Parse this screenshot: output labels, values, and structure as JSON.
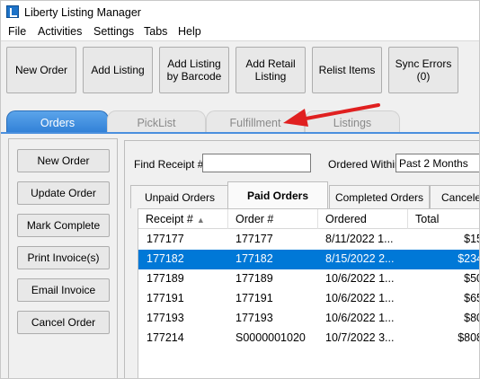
{
  "app": {
    "title": "Liberty Listing Manager"
  },
  "menu": [
    "File",
    "Activities",
    "Settings",
    "Tabs",
    "Help"
  ],
  "toolbar": {
    "new_order": "New Order",
    "add_listing": "Add Listing",
    "add_by_barcode": "Add Listing\nby Barcode",
    "add_retail": "Add Retail\nListing",
    "relist": "Relist Items",
    "sync_errors": "Sync Errors\n(0)"
  },
  "main_tabs": {
    "orders": "Orders",
    "picklist": "PickList",
    "fulfillment": "Fulfillment",
    "listings": "Listings",
    "active": "Orders"
  },
  "side_actions": {
    "new_order": "New Order",
    "update_order": "Update Order",
    "mark_complete": "Mark Complete",
    "print_invoice": "Print Invoice(s)",
    "email_invoice": "Email Invoice",
    "cancel_order": "Cancel Order"
  },
  "filters": {
    "find_receipt_label": "Find Receipt #",
    "find_receipt_value": "",
    "ordered_within_label": "Ordered Within",
    "ordered_within_value": "Past 2 Months"
  },
  "order_tabs": {
    "unpaid": "Unpaid Orders",
    "paid": "Paid Orders",
    "completed": "Completed Orders",
    "canceled": "Canceled",
    "active": "Paid Orders"
  },
  "table": {
    "columns": {
      "receipt": "Receipt #",
      "order": "Order #",
      "ordered": "Ordered",
      "total": "Total"
    },
    "sort_column": "Receipt #",
    "sort_direction": "ascending",
    "rows": [
      {
        "receipt": "177177",
        "order": "177177",
        "ordered": "8/11/2022 1...",
        "total": "$15",
        "selected": false
      },
      {
        "receipt": "177182",
        "order": "177182",
        "ordered": "8/15/2022 2...",
        "total": "$234",
        "selected": true
      },
      {
        "receipt": "177189",
        "order": "177189",
        "ordered": "10/6/2022 1...",
        "total": "$50",
        "selected": false
      },
      {
        "receipt": "177191",
        "order": "177191",
        "ordered": "10/6/2022 1...",
        "total": "$65",
        "selected": false
      },
      {
        "receipt": "177193",
        "order": "177193",
        "ordered": "10/6/2022 1...",
        "total": "$80",
        "selected": false
      },
      {
        "receipt": "177214",
        "order": "S0000001020",
        "ordered": "10/7/2022 3...",
        "total": "$808",
        "selected": false
      }
    ]
  },
  "colors": {
    "selection": "#0078d7",
    "active_tab": "#3b8be0",
    "annotation_arrow": "#e02020"
  }
}
